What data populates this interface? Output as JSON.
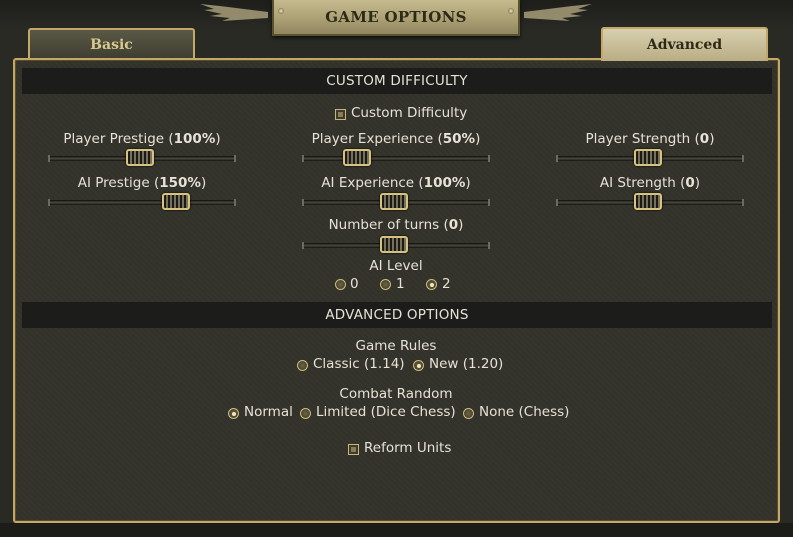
{
  "title": "GAME OPTIONS",
  "tabs": [
    {
      "label": "Basic",
      "active": false
    },
    {
      "label": "Advanced",
      "active": true
    }
  ],
  "custom_difficulty": {
    "header": "CUSTOM DIFFICULTY",
    "checkbox_label": "Custom Difficulty",
    "sliders": {
      "player_prestige": {
        "label": "Player Prestige",
        "value": "100%",
        "position": 0.49
      },
      "player_experience": {
        "label": "Player Experience",
        "value": "50%",
        "position": 0.29
      },
      "player_strength": {
        "label": "Player Strength",
        "value": "0",
        "position": 0.49
      },
      "ai_prestige": {
        "label": "AI Prestige",
        "value": "150%",
        "position": 0.68
      },
      "ai_experience": {
        "label": "AI Experience",
        "value": "100%",
        "position": 0.49
      },
      "ai_strength": {
        "label": "AI Strength",
        "value": "0",
        "position": 0.49
      },
      "number_of_turns": {
        "label": "Number of turns",
        "value": "0",
        "position": 0.49
      }
    },
    "ai_level": {
      "label": "AI Level",
      "options": [
        "0",
        "1",
        "2"
      ],
      "selected": "2"
    }
  },
  "advanced_options": {
    "header": "ADVANCED OPTIONS",
    "game_rules": {
      "label": "Game Rules",
      "options": [
        "Classic (1.14)",
        "New (1.20)"
      ],
      "selected": "New (1.20)"
    },
    "combat_random": {
      "label": "Combat Random",
      "options": [
        "Normal",
        "Limited (Dice Chess)",
        "None (Chess)"
      ],
      "selected": "Normal"
    },
    "reform_units_label": "Reform Units"
  },
  "colors": {
    "accent_gold": "#c4a868",
    "panel_bg": "#33332c",
    "header_bg": "#1c1c1a"
  }
}
